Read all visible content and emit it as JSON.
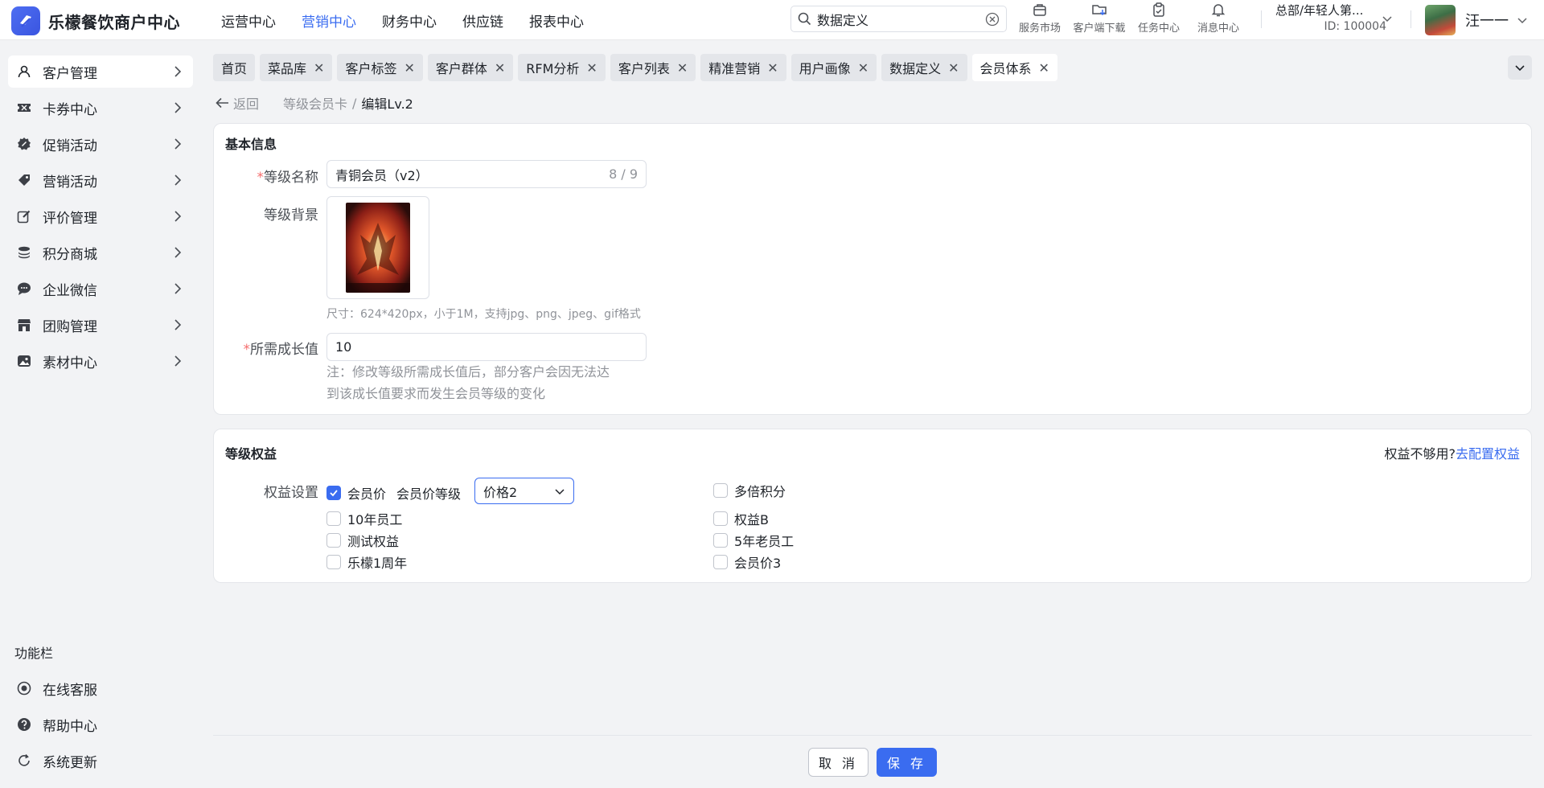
{
  "app": {
    "title": "乐檬餐饮商户中心"
  },
  "topnav": [
    "运营中心",
    "营销中心",
    "财务中心",
    "供应链",
    "报表中心"
  ],
  "search": {
    "value": "数据定义"
  },
  "tools": [
    "服务市场",
    "客户端下载",
    "任务中心",
    "消息中心"
  ],
  "org": {
    "name": "总部/年轻人第...",
    "id": "ID: 100004"
  },
  "user": {
    "name": "汪一一"
  },
  "sidebar": {
    "items": [
      "客户管理",
      "卡券中心",
      "促销活动",
      "营销活动",
      "评价管理",
      "积分商城",
      "企业微信",
      "团购管理",
      "素材中心"
    ],
    "func_title": "功能栏",
    "func_items": [
      "在线客服",
      "帮助中心",
      "系统更新"
    ]
  },
  "tabs": [
    "首页",
    "菜品库",
    "客户标签",
    "客户群体",
    "RFM分析",
    "客户列表",
    "精准营销",
    "用户画像",
    "数据定义",
    "会员体系"
  ],
  "breadcrumb": {
    "back": "返回",
    "parent": "等级会员卡",
    "separator": "/",
    "current": "编辑Lv.2"
  },
  "basic": {
    "title": "基本信息",
    "required_mark": "*",
    "name_label": "等级名称",
    "name_value": "青铜会员（v2）",
    "name_count": "8 / 9",
    "bg_label": "等级背景",
    "bg_hint": "尺寸：624*420px，小于1M，支持jpg、png、jpeg、gif格式",
    "growth_label": "所需成长值",
    "growth_value": "10",
    "note_line1": "注：修改等级所需成长值后，部分客户会因无法达",
    "note_line2": "到该成长值要求而发生会员等级的变化"
  },
  "rights": {
    "title": "等级权益",
    "hint_text": "权益不够用?",
    "hint_link": "去配置权益",
    "setting_label": "权益设置",
    "member_price": "会员价",
    "member_level_label": "会员价等级",
    "member_level_value": "价格2",
    "left": [
      "10年员工",
      "测试权益",
      "乐檬1周年"
    ],
    "right": [
      "多倍积分",
      "权益B",
      "5年老员工",
      "会员价3"
    ]
  },
  "footer": {
    "cancel": "取 消",
    "save": "保 存"
  },
  "colors": {
    "accent": "#3a6cf0",
    "required": "#f56c6c"
  }
}
